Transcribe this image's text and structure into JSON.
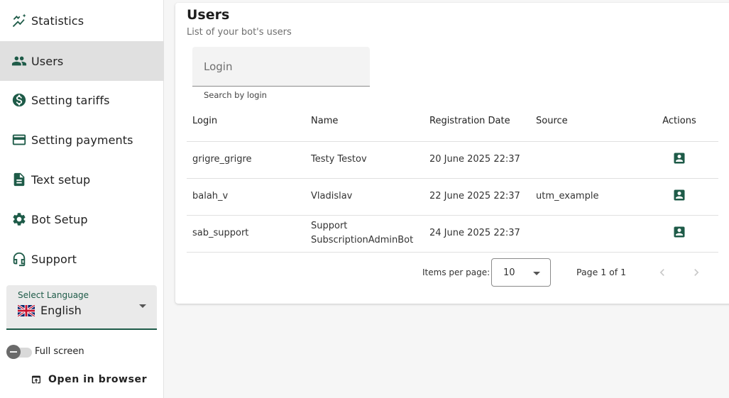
{
  "sidebar": {
    "items": [
      {
        "label": "Statistics",
        "icon": "chart-line-icon"
      },
      {
        "label": "Users",
        "icon": "users-icon",
        "active": true
      },
      {
        "label": "Setting tariffs",
        "icon": "dollar-icon"
      },
      {
        "label": "Setting payments",
        "icon": "credit-card-icon"
      },
      {
        "label": "Text setup",
        "icon": "document-icon"
      },
      {
        "label": "Bot Setup",
        "icon": "gear-icon"
      },
      {
        "label": "Support",
        "icon": "support-icon"
      }
    ],
    "language": {
      "caption": "Select Language",
      "value": "English",
      "flag": "uk-flag-icon"
    },
    "fullscreen_label": "Full screen",
    "open_browser_label": "Open in browser"
  },
  "main": {
    "title": "Users",
    "subtitle": "List of your bot's users",
    "search": {
      "placeholder": "Login",
      "value": "",
      "hint": "Search by login"
    },
    "table": {
      "headers": {
        "login": "Login",
        "name": "Name",
        "date": "Registration Date",
        "source": "Source",
        "actions": "Actions"
      },
      "rows": [
        {
          "login": "grigre_grigre",
          "name": "Testy Testov",
          "date": "20 June 2025 22:37",
          "source": ""
        },
        {
          "login": "balah_v",
          "name": "Vladislav",
          "date": "22 June 2025 22:37",
          "source": "utm_example"
        },
        {
          "login": "sab_support",
          "name": "Support SubscriptionAdminBot",
          "date": "24 June 2025 22:37",
          "source": ""
        }
      ]
    },
    "pagination": {
      "items_per_page_label": "Items per page:",
      "items_per_page": "10",
      "range": "Page 1 of 1"
    }
  },
  "colors": {
    "accent": "#1e5b48",
    "active_bg": "#e0e0e0",
    "page_bg": "#f6f6f6"
  }
}
